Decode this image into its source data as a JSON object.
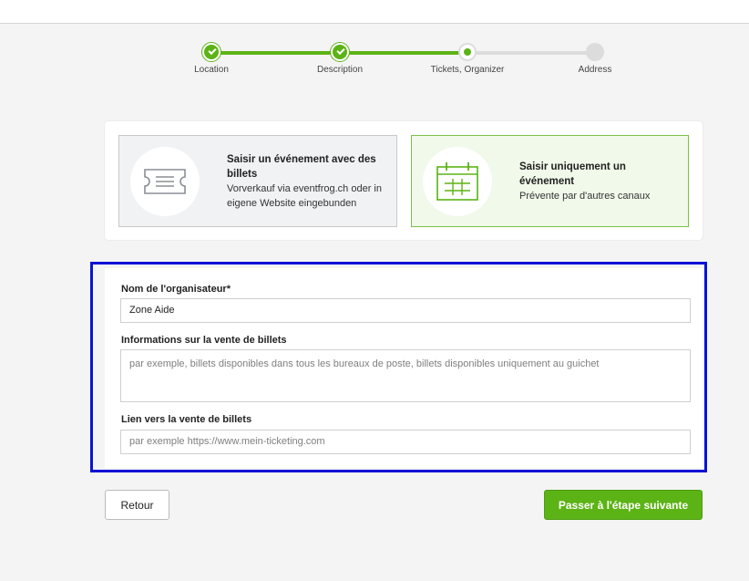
{
  "stepper": {
    "steps": [
      {
        "label": "Location",
        "state": "done"
      },
      {
        "label": "Description",
        "state": "done"
      },
      {
        "label": "Tickets, Organizer",
        "state": "current"
      },
      {
        "label": "Address",
        "state": "todo"
      }
    ]
  },
  "mode": {
    "with_tickets": {
      "title": "Saisir un événement avec des billets",
      "subtitle": "Vorverkauf via eventfrog.ch oder in eigene Website eingebunden",
      "icon": "ticket-icon",
      "selected": false
    },
    "event_only": {
      "title": "Saisir uniquement un événement",
      "subtitle": "Prévente par d'autres canaux",
      "icon": "calendar-icon",
      "selected": true
    }
  },
  "organizer_form": {
    "name_label": "Nom de l'organisateur*",
    "name_value": "Zone Aide",
    "info_label": "Informations sur la vente de billets",
    "info_placeholder": "par exemple, billets disponibles dans tous les bureaux de poste, billets disponibles uniquement au guichet",
    "link_label": "Lien vers la vente de billets",
    "link_placeholder": "par exemple https://www.mein-ticketing.com"
  },
  "footer": {
    "back_label": "Retour",
    "next_label": "Passer à l'étape suivante"
  },
  "colors": {
    "accent": "#5cb315",
    "highlight_border": "#0a12d6"
  }
}
